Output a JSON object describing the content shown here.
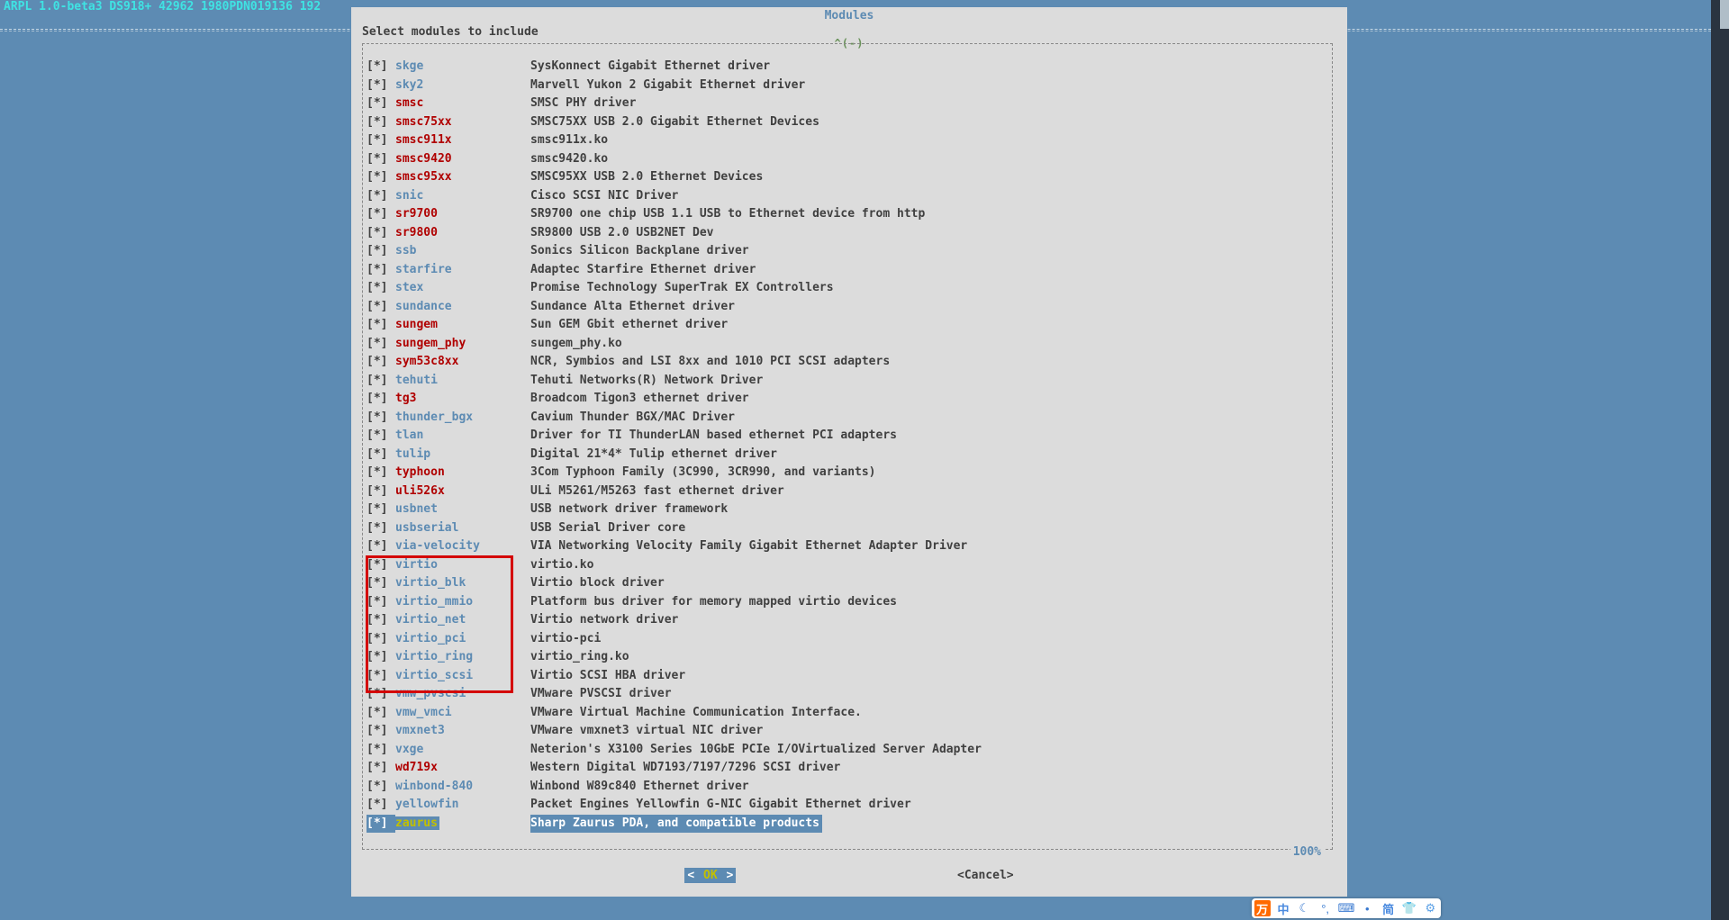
{
  "topbar": "ARPL 1.0-beta3 DS918+ 42962 1980PDN019136 192",
  "dialog": {
    "title": "Modules",
    "prompt": "Select modules to include",
    "arrow_hint": "^(-)",
    "percent": "100%",
    "ok_left": "<  ",
    "ok_label": "OK",
    "ok_right": "  >",
    "cancel_label": "<Cancel>"
  },
  "modules": [
    {
      "chk": "[*]",
      "name": "skge",
      "cls": "blue",
      "desc": "SysKonnect Gigabit Ethernet driver"
    },
    {
      "chk": "[*]",
      "name": "sky2",
      "cls": "blue",
      "desc": "Marvell Yukon 2 Gigabit Ethernet driver"
    },
    {
      "chk": "[*]",
      "name": "smsc",
      "cls": "red",
      "desc": "SMSC PHY driver"
    },
    {
      "chk": "[*]",
      "name": "smsc75xx",
      "cls": "red",
      "desc": "SMSC75XX USB 2.0 Gigabit Ethernet Devices"
    },
    {
      "chk": "[*]",
      "name": "smsc911x",
      "cls": "red",
      "desc": "smsc911x.ko"
    },
    {
      "chk": "[*]",
      "name": "smsc9420",
      "cls": "red",
      "desc": "smsc9420.ko"
    },
    {
      "chk": "[*]",
      "name": "smsc95xx",
      "cls": "red",
      "desc": "SMSC95XX USB 2.0 Ethernet Devices"
    },
    {
      "chk": "[*]",
      "name": "snic",
      "cls": "blue",
      "desc": "Cisco SCSI NIC Driver"
    },
    {
      "chk": "[*]",
      "name": "sr9700",
      "cls": "red",
      "desc": "SR9700 one chip USB 1.1 USB to Ethernet device from http"
    },
    {
      "chk": "[*]",
      "name": "sr9800",
      "cls": "red",
      "desc": "SR9800 USB 2.0 USB2NET Dev"
    },
    {
      "chk": "[*]",
      "name": "ssb",
      "cls": "blue",
      "desc": "Sonics Silicon Backplane driver"
    },
    {
      "chk": "[*]",
      "name": "starfire",
      "cls": "blue",
      "desc": "Adaptec Starfire Ethernet driver"
    },
    {
      "chk": "[*]",
      "name": "stex",
      "cls": "blue",
      "desc": "Promise Technology SuperTrak EX Controllers"
    },
    {
      "chk": "[*]",
      "name": "sundance",
      "cls": "blue",
      "desc": "Sundance Alta Ethernet driver"
    },
    {
      "chk": "[*]",
      "name": "sungem",
      "cls": "red",
      "desc": "Sun GEM Gbit ethernet driver"
    },
    {
      "chk": "[*]",
      "name": "sungem_phy",
      "cls": "red",
      "desc": "sungem_phy.ko"
    },
    {
      "chk": "[*]",
      "name": "sym53c8xx",
      "cls": "red",
      "desc": "NCR, Symbios and LSI 8xx and 1010 PCI SCSI adapters"
    },
    {
      "chk": "[*]",
      "name": "tehuti",
      "cls": "blue",
      "desc": "Tehuti Networks(R) Network Driver"
    },
    {
      "chk": "[*]",
      "name": "tg3",
      "cls": "red",
      "desc": "Broadcom Tigon3 ethernet driver"
    },
    {
      "chk": "[*]",
      "name": "thunder_bgx",
      "cls": "blue",
      "desc": "Cavium Thunder BGX/MAC Driver"
    },
    {
      "chk": "[*]",
      "name": "tlan",
      "cls": "blue",
      "desc": "Driver for TI ThunderLAN based ethernet PCI adapters"
    },
    {
      "chk": "[*]",
      "name": "tulip",
      "cls": "blue",
      "desc": "Digital 21*4* Tulip ethernet driver"
    },
    {
      "chk": "[*]",
      "name": "typhoon",
      "cls": "red",
      "desc": "3Com Typhoon Family (3C990, 3CR990, and variants)"
    },
    {
      "chk": "[*]",
      "name": "uli526x",
      "cls": "red",
      "desc": "ULi M5261/M5263 fast ethernet driver"
    },
    {
      "chk": "[*]",
      "name": "usbnet",
      "cls": "blue",
      "desc": "USB network driver framework"
    },
    {
      "chk": "[*]",
      "name": "usbserial",
      "cls": "blue",
      "desc": "USB Serial Driver core"
    },
    {
      "chk": "[*]",
      "name": "via-velocity",
      "cls": "blue",
      "desc": "VIA Networking Velocity Family Gigabit Ethernet Adapter Driver"
    },
    {
      "chk": "[*]",
      "name": "virtio",
      "cls": "blue",
      "desc": "virtio.ko"
    },
    {
      "chk": "[*]",
      "name": "virtio_blk",
      "cls": "blue",
      "desc": "Virtio block driver"
    },
    {
      "chk": "[*]",
      "name": "virtio_mmio",
      "cls": "blue",
      "desc": "Platform bus driver for memory mapped virtio devices"
    },
    {
      "chk": "[*]",
      "name": "virtio_net",
      "cls": "blue",
      "desc": "Virtio network driver"
    },
    {
      "chk": "[*]",
      "name": "virtio_pci",
      "cls": "blue",
      "desc": "virtio-pci"
    },
    {
      "chk": "[*]",
      "name": "virtio_ring",
      "cls": "blue",
      "desc": "virtio_ring.ko"
    },
    {
      "chk": "[*]",
      "name": "virtio_scsi",
      "cls": "blue",
      "desc": "Virtio SCSI HBA driver"
    },
    {
      "chk": "[*]",
      "name": "vmw_pvscsi",
      "cls": "blue",
      "desc": "VMware PVSCSI driver"
    },
    {
      "chk": "[*]",
      "name": "vmw_vmci",
      "cls": "blue",
      "desc": "VMware Virtual Machine Communication Interface."
    },
    {
      "chk": "[*]",
      "name": "vmxnet3",
      "cls": "blue",
      "desc": "VMware vmxnet3 virtual NIC driver"
    },
    {
      "chk": "[*]",
      "name": "vxge",
      "cls": "blue",
      "desc": "Neterion's X3100 Series 10GbE PCIe I/OVirtualized Server Adapter"
    },
    {
      "chk": "[*]",
      "name": "wd719x",
      "cls": "red",
      "desc": "Western Digital WD7193/7197/7296 SCSI driver"
    },
    {
      "chk": "[*]",
      "name": "winbond-840",
      "cls": "blue",
      "desc": "Winbond W89c840 Ethernet driver"
    },
    {
      "chk": "[*]",
      "name": "yellowfin",
      "cls": "blue",
      "desc": "Packet Engines Yellowfin G-NIC Gigabit Ethernet driver"
    },
    {
      "chk": "[*]",
      "name": "zaurus",
      "cls": "olive",
      "desc": "Sharp Zaurus PDA, and compatible products",
      "selected": true
    }
  ],
  "ime": {
    "logo": "万",
    "lang": "中",
    "moon": "☾",
    "punct": "°,",
    "kbd": "⌨",
    "person": "•",
    "simp": "简",
    "shirt": "👕",
    "gear": "⚙"
  }
}
